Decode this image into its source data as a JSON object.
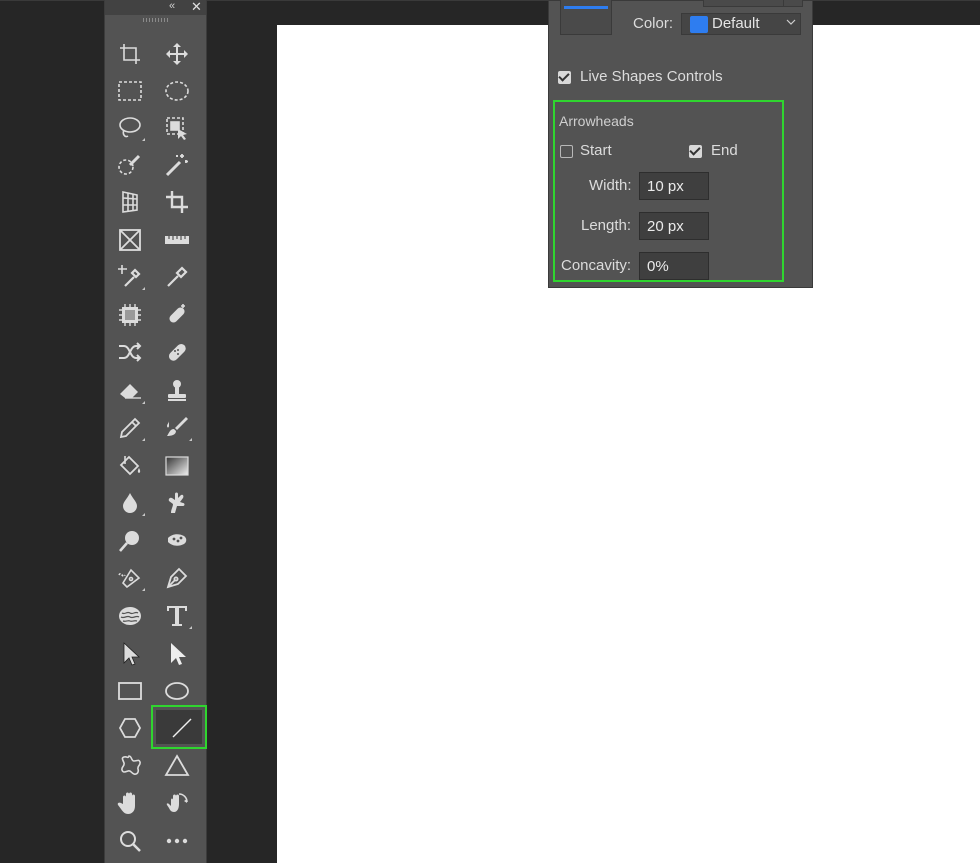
{
  "toolbar": {
    "collapse_glyph": "«",
    "close_glyph": "✕",
    "tools": [
      {
        "name": "artboard-tool-icon",
        "hasmenu": false
      },
      {
        "name": "move-tool-icon",
        "hasmenu": false
      },
      {
        "name": "rectangular-marquee-icon",
        "hasmenu": false
      },
      {
        "name": "elliptical-marquee-icon",
        "hasmenu": false
      },
      {
        "name": "lasso-icon",
        "hasmenu": true
      },
      {
        "name": "object-selection-icon",
        "hasmenu": false
      },
      {
        "name": "quick-selection-icon",
        "hasmenu": false
      },
      {
        "name": "magic-wand-icon",
        "hasmenu": false
      },
      {
        "name": "perspective-crop-icon",
        "hasmenu": false
      },
      {
        "name": "crop-icon",
        "hasmenu": false
      },
      {
        "name": "frame-tool-icon",
        "hasmenu": false
      },
      {
        "name": "ruler-icon",
        "hasmenu": false
      },
      {
        "name": "color-sampler-icon",
        "hasmenu": true
      },
      {
        "name": "eyedropper-icon",
        "hasmenu": false
      },
      {
        "name": "content-aware-icon",
        "hasmenu": false
      },
      {
        "name": "spot-healing-icon",
        "hasmenu": false
      },
      {
        "name": "content-aware-move-icon",
        "hasmenu": false
      },
      {
        "name": "healing-brush-icon",
        "hasmenu": false
      },
      {
        "name": "eraser-icon",
        "hasmenu": true
      },
      {
        "name": "clone-stamp-icon",
        "hasmenu": false
      },
      {
        "name": "pencil-icon",
        "hasmenu": true
      },
      {
        "name": "brush-icon",
        "hasmenu": true
      },
      {
        "name": "paint-bucket-icon",
        "hasmenu": false
      },
      {
        "name": "gradient-icon",
        "hasmenu": false
      },
      {
        "name": "blur-icon",
        "hasmenu": true
      },
      {
        "name": "smudge-icon",
        "hasmenu": false
      },
      {
        "name": "dodge-icon",
        "hasmenu": false
      },
      {
        "name": "sponge-icon",
        "hasmenu": false
      },
      {
        "name": "freeform-pen-icon",
        "hasmenu": true
      },
      {
        "name": "pen-icon",
        "hasmenu": false
      },
      {
        "name": "sphere-3d-icon",
        "hasmenu": false
      },
      {
        "name": "type-icon",
        "hasmenu": true
      },
      {
        "name": "path-selection-icon",
        "hasmenu": false
      },
      {
        "name": "direct-selection-icon",
        "hasmenu": false
      },
      {
        "name": "rectangle-icon",
        "hasmenu": false
      },
      {
        "name": "ellipse-icon",
        "hasmenu": false
      },
      {
        "name": "polygon-icon",
        "hasmenu": false
      },
      {
        "name": "line-tool-icon",
        "hasmenu": false,
        "selected": true
      },
      {
        "name": "custom-shape-icon",
        "hasmenu": false
      },
      {
        "name": "triangle-icon",
        "hasmenu": false
      },
      {
        "name": "hand-icon",
        "hasmenu": false
      },
      {
        "name": "rotate-view-icon",
        "hasmenu": false
      },
      {
        "name": "zoom-icon",
        "hasmenu": false
      },
      {
        "name": "more-tools-icon",
        "hasmenu": false
      }
    ]
  },
  "panel": {
    "color_label": "Color:",
    "color_value": "Default",
    "live_shapes_label": "Live Shapes Controls",
    "live_shapes_checked": true,
    "arrowheads": {
      "title": "Arrowheads",
      "start_label": "Start",
      "start_checked": false,
      "end_label": "End",
      "end_checked": true,
      "width_label": "Width:",
      "width_value": "10 px",
      "length_label": "Length:",
      "length_value": "20 px",
      "concavity_label": "Concavity:",
      "concavity_value": "0%"
    }
  },
  "colors": {
    "accent_blue": "#2e7df0",
    "highlight_green": "#2fd52f",
    "canvas": "#ffffff"
  }
}
